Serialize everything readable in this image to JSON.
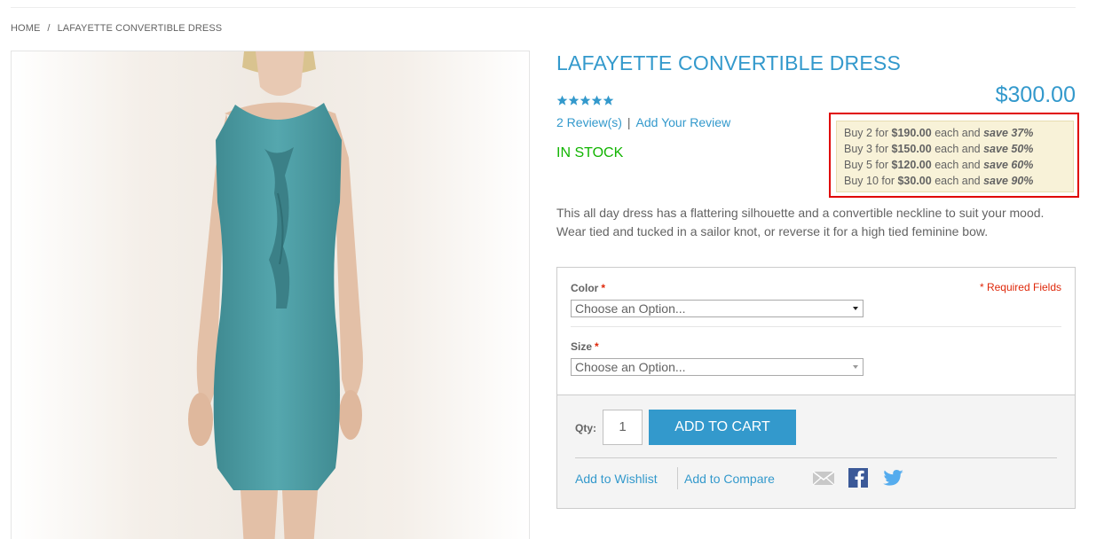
{
  "breadcrumb": {
    "home": "HOME",
    "separator": "/",
    "current": "LAFAYETTE CONVERTIBLE DRESS"
  },
  "product": {
    "title": "LAFAYETTE CONVERTIBLE DRESS",
    "price": "$300.00",
    "rating_stars": 5,
    "reviews_link": "2 Review(s)",
    "review_separator": "|",
    "add_review_link": "Add Your Review",
    "stock_status": "IN STOCK",
    "description": "This all day dress has a flattering silhouette and a convertible neckline to suit your mood. Wear tied and tucked in a sailor knot, or reverse it for a high tied feminine bow."
  },
  "tier_prices": [
    {
      "prefix": "Buy 2 for",
      "price": "$190.00",
      "middle": "each and",
      "save": "save 37%"
    },
    {
      "prefix": "Buy 3 for",
      "price": "$150.00",
      "middle": "each and",
      "save": "save 50%"
    },
    {
      "prefix": "Buy 5 for",
      "price": "$120.00",
      "middle": "each and",
      "save": "save 60%"
    },
    {
      "prefix": "Buy 10 for",
      "price": "$30.00",
      "middle": "each and",
      "save": "save 90%"
    }
  ],
  "options": {
    "required_note": "* Required Fields",
    "color_label": "Color",
    "color_value": "Choose an Option...",
    "size_label": "Size",
    "size_value": "Choose an Option...",
    "required_marker": "*"
  },
  "cart": {
    "qty_label": "Qty:",
    "qty_value": "1",
    "add_to_cart_label": "ADD TO CART",
    "wishlist_label": "Add to Wishlist",
    "compare_label": "Add to Compare"
  },
  "icons": {
    "email": "email-icon",
    "facebook": "facebook-icon",
    "twitter": "twitter-icon",
    "star": "star-icon"
  },
  "colors": {
    "accent": "#3399cc",
    "in_stock": "#11b400",
    "required": "#df280a",
    "tier_bg": "#f8f2d8",
    "highlight_outline": "#e00000",
    "dress": "#4e9fa6"
  }
}
